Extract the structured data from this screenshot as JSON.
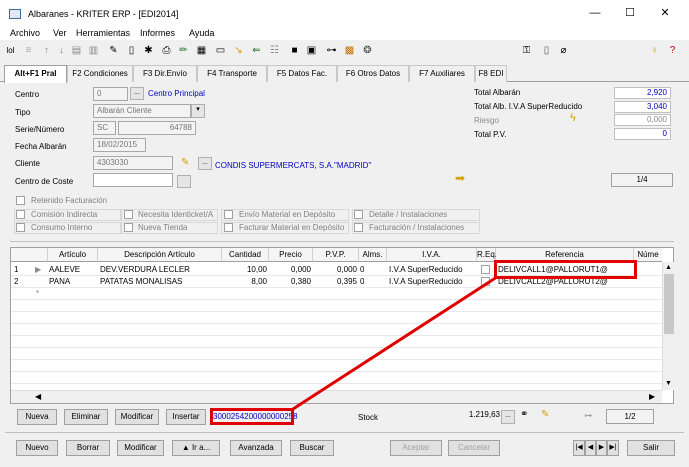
{
  "window": {
    "title": "Albaranes - KRITER ERP -  [EDI2014]",
    "minimize": "—",
    "maximize": "☐",
    "close": "✕"
  },
  "menu": [
    "Archivo",
    "Ver",
    "Herramientas",
    "Informes",
    "Ayuda"
  ],
  "tabs": [
    "Alt+F1 Pral",
    "F2 Condiciones",
    "F3 Dir.Envío",
    "F4 Transporte",
    "F5 Datos Fac.",
    "F6 Otros Datos",
    "F7 Auxiliares",
    "F8 EDI"
  ],
  "form": {
    "centro_label": "Centro",
    "centro_value": "0",
    "centro_name": "Centro Principal",
    "tipo_label": "Tipo",
    "tipo_value": "Albarán Cliente",
    "serie_label": "Serie/Número",
    "serie_value": "SC",
    "numero_value": "64788",
    "fecha_label": "Fecha Albarán",
    "fecha_value": "18/02/2015",
    "cliente_label": "Cliente",
    "cliente_value": "4303030",
    "cliente_name": "CONDIS SUPERMERCATS, S.A.\"MADRID\"",
    "coste_label": "Centro de Coste"
  },
  "totals": {
    "total_albaran_label": "Total Albarán",
    "total_albaran": "2,920",
    "total_iva_label": "Total Alb. I.V.A SuperReducido",
    "total_iva": "3,040",
    "riesgo_label": "Riesgo",
    "riesgo": "0,000",
    "total_pv_label": "Total P.V.",
    "total_pv": "0",
    "page": "1/4"
  },
  "checks": {
    "retenido": "Retenido Facturación",
    "comision": "Comisión Indirecta",
    "identicket": "Necesita Identicket/A",
    "envio": "Envío Material en Depósito",
    "detalle": "Detalle / Instalaciones",
    "consumo": "Consumo Interno",
    "tienda": "Nueva Tienda",
    "facturar": "Facturar Material en Depósito",
    "facturacion": "Facturación / Instalaciones"
  },
  "grid": {
    "headers": [
      "Artículo",
      "Descripción Artículo",
      "Cantidad",
      "Precio",
      "P.V.P.",
      "Alms.",
      "I.V.A.",
      "R.Eq.",
      "Referencia",
      "Núme"
    ],
    "rows": [
      {
        "n": "1",
        "articulo": "AALEVE",
        "desc": "DEV.VERDURA LECLER",
        "cantidad": "10,00",
        "precio": "0,000",
        "pvp": "0,000",
        "alms": "0",
        "iva": "I.V.A SuperReducido",
        "ref": "DELIVCALL1@PALLORUT1@"
      },
      {
        "n": "2",
        "articulo": "PANA",
        "desc": "PATATAS MONALISAS",
        "cantidad": "8,00",
        "precio": "0,380",
        "pvp": "0,395",
        "alms": "0",
        "iva": "I.V.A SuperReducido",
        "ref": "DELIVCALL2@PALLORUT2@"
      }
    ],
    "new_row_marker": "*"
  },
  "line_buttons": {
    "nueva": "Nueva",
    "eliminar": "Eliminar",
    "modificar": "Modificar",
    "insertar": "Insertar"
  },
  "barcode": "3000254200000000258",
  "stock_label": "Stock",
  "stock_value": "1.219,63",
  "line_page": "1/2",
  "bottom_buttons": {
    "nuevo": "Nuevo",
    "borrar": "Borrar",
    "modificar": "Modificar",
    "ira": "▲ Ir a...",
    "avanzada": "Avanzada",
    "buscar": "Buscar",
    "aceptar": "Aceptar",
    "cancelar": "Cancelar",
    "salir": "Salir"
  }
}
